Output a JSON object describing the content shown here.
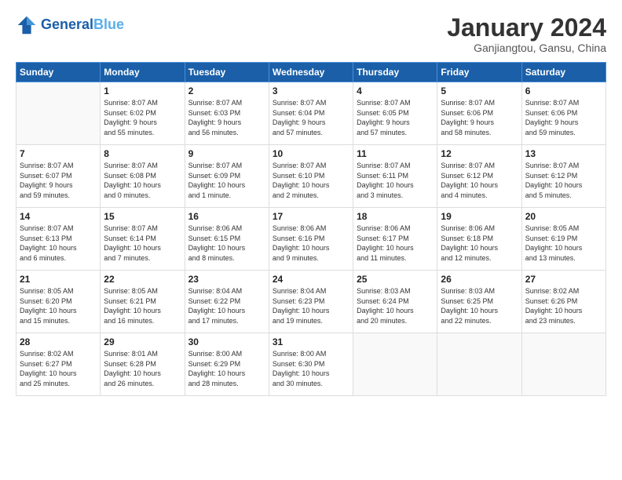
{
  "header": {
    "logo_line1": "General",
    "logo_line2": "Blue",
    "month_title": "January 2024",
    "subtitle": "Ganjiangtou, Gansu, China"
  },
  "weekdays": [
    "Sunday",
    "Monday",
    "Tuesday",
    "Wednesday",
    "Thursday",
    "Friday",
    "Saturday"
  ],
  "weeks": [
    [
      {
        "day": "",
        "info": ""
      },
      {
        "day": "1",
        "info": "Sunrise: 8:07 AM\nSunset: 6:02 PM\nDaylight: 9 hours\nand 55 minutes."
      },
      {
        "day": "2",
        "info": "Sunrise: 8:07 AM\nSunset: 6:03 PM\nDaylight: 9 hours\nand 56 minutes."
      },
      {
        "day": "3",
        "info": "Sunrise: 8:07 AM\nSunset: 6:04 PM\nDaylight: 9 hours\nand 57 minutes."
      },
      {
        "day": "4",
        "info": "Sunrise: 8:07 AM\nSunset: 6:05 PM\nDaylight: 9 hours\nand 57 minutes."
      },
      {
        "day": "5",
        "info": "Sunrise: 8:07 AM\nSunset: 6:06 PM\nDaylight: 9 hours\nand 58 minutes."
      },
      {
        "day": "6",
        "info": "Sunrise: 8:07 AM\nSunset: 6:06 PM\nDaylight: 9 hours\nand 59 minutes."
      }
    ],
    [
      {
        "day": "7",
        "info": "Sunrise: 8:07 AM\nSunset: 6:07 PM\nDaylight: 9 hours\nand 59 minutes."
      },
      {
        "day": "8",
        "info": "Sunrise: 8:07 AM\nSunset: 6:08 PM\nDaylight: 10 hours\nand 0 minutes."
      },
      {
        "day": "9",
        "info": "Sunrise: 8:07 AM\nSunset: 6:09 PM\nDaylight: 10 hours\nand 1 minute."
      },
      {
        "day": "10",
        "info": "Sunrise: 8:07 AM\nSunset: 6:10 PM\nDaylight: 10 hours\nand 2 minutes."
      },
      {
        "day": "11",
        "info": "Sunrise: 8:07 AM\nSunset: 6:11 PM\nDaylight: 10 hours\nand 3 minutes."
      },
      {
        "day": "12",
        "info": "Sunrise: 8:07 AM\nSunset: 6:12 PM\nDaylight: 10 hours\nand 4 minutes."
      },
      {
        "day": "13",
        "info": "Sunrise: 8:07 AM\nSunset: 6:12 PM\nDaylight: 10 hours\nand 5 minutes."
      }
    ],
    [
      {
        "day": "14",
        "info": "Sunrise: 8:07 AM\nSunset: 6:13 PM\nDaylight: 10 hours\nand 6 minutes."
      },
      {
        "day": "15",
        "info": "Sunrise: 8:07 AM\nSunset: 6:14 PM\nDaylight: 10 hours\nand 7 minutes."
      },
      {
        "day": "16",
        "info": "Sunrise: 8:06 AM\nSunset: 6:15 PM\nDaylight: 10 hours\nand 8 minutes."
      },
      {
        "day": "17",
        "info": "Sunrise: 8:06 AM\nSunset: 6:16 PM\nDaylight: 10 hours\nand 9 minutes."
      },
      {
        "day": "18",
        "info": "Sunrise: 8:06 AM\nSunset: 6:17 PM\nDaylight: 10 hours\nand 11 minutes."
      },
      {
        "day": "19",
        "info": "Sunrise: 8:06 AM\nSunset: 6:18 PM\nDaylight: 10 hours\nand 12 minutes."
      },
      {
        "day": "20",
        "info": "Sunrise: 8:05 AM\nSunset: 6:19 PM\nDaylight: 10 hours\nand 13 minutes."
      }
    ],
    [
      {
        "day": "21",
        "info": "Sunrise: 8:05 AM\nSunset: 6:20 PM\nDaylight: 10 hours\nand 15 minutes."
      },
      {
        "day": "22",
        "info": "Sunrise: 8:05 AM\nSunset: 6:21 PM\nDaylight: 10 hours\nand 16 minutes."
      },
      {
        "day": "23",
        "info": "Sunrise: 8:04 AM\nSunset: 6:22 PM\nDaylight: 10 hours\nand 17 minutes."
      },
      {
        "day": "24",
        "info": "Sunrise: 8:04 AM\nSunset: 6:23 PM\nDaylight: 10 hours\nand 19 minutes."
      },
      {
        "day": "25",
        "info": "Sunrise: 8:03 AM\nSunset: 6:24 PM\nDaylight: 10 hours\nand 20 minutes."
      },
      {
        "day": "26",
        "info": "Sunrise: 8:03 AM\nSunset: 6:25 PM\nDaylight: 10 hours\nand 22 minutes."
      },
      {
        "day": "27",
        "info": "Sunrise: 8:02 AM\nSunset: 6:26 PM\nDaylight: 10 hours\nand 23 minutes."
      }
    ],
    [
      {
        "day": "28",
        "info": "Sunrise: 8:02 AM\nSunset: 6:27 PM\nDaylight: 10 hours\nand 25 minutes."
      },
      {
        "day": "29",
        "info": "Sunrise: 8:01 AM\nSunset: 6:28 PM\nDaylight: 10 hours\nand 26 minutes."
      },
      {
        "day": "30",
        "info": "Sunrise: 8:00 AM\nSunset: 6:29 PM\nDaylight: 10 hours\nand 28 minutes."
      },
      {
        "day": "31",
        "info": "Sunrise: 8:00 AM\nSunset: 6:30 PM\nDaylight: 10 hours\nand 30 minutes."
      },
      {
        "day": "",
        "info": ""
      },
      {
        "day": "",
        "info": ""
      },
      {
        "day": "",
        "info": ""
      }
    ]
  ]
}
